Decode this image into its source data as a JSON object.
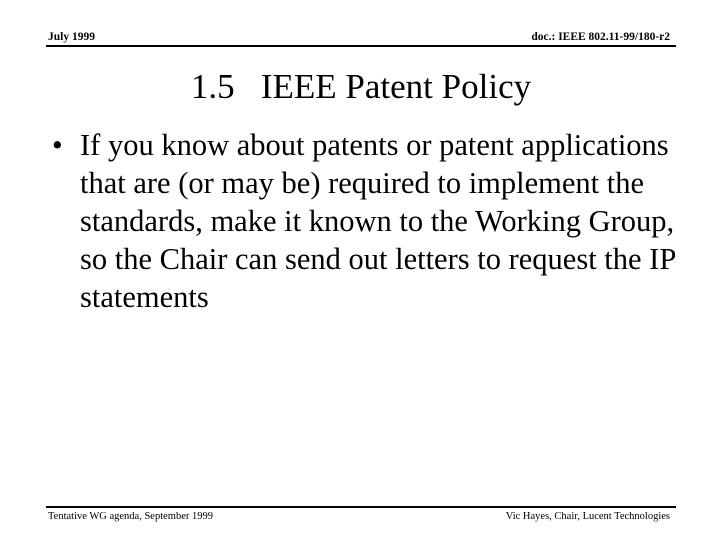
{
  "slide": {
    "header": {
      "left_text": "July 1999",
      "right_text": "doc.: IEEE 802.11-99/180-r2"
    },
    "title": "1.5   IEEE Patent Policy",
    "body": {
      "bullets": [
        {
          "glyph": "•",
          "text": "If you know about patents or patent applications that are (or may be) required to implement the standards, make it known to the Working Group, so the Chair can send out letters to request the IP statements"
        }
      ]
    },
    "footer": {
      "left_text": "Tentative WG agenda, September 1999",
      "right_text": "Vic Hayes, Chair, Lucent Technologies"
    },
    "colors": {
      "background": "#ffffff",
      "text": "#000000",
      "rule": "#000000"
    }
  }
}
